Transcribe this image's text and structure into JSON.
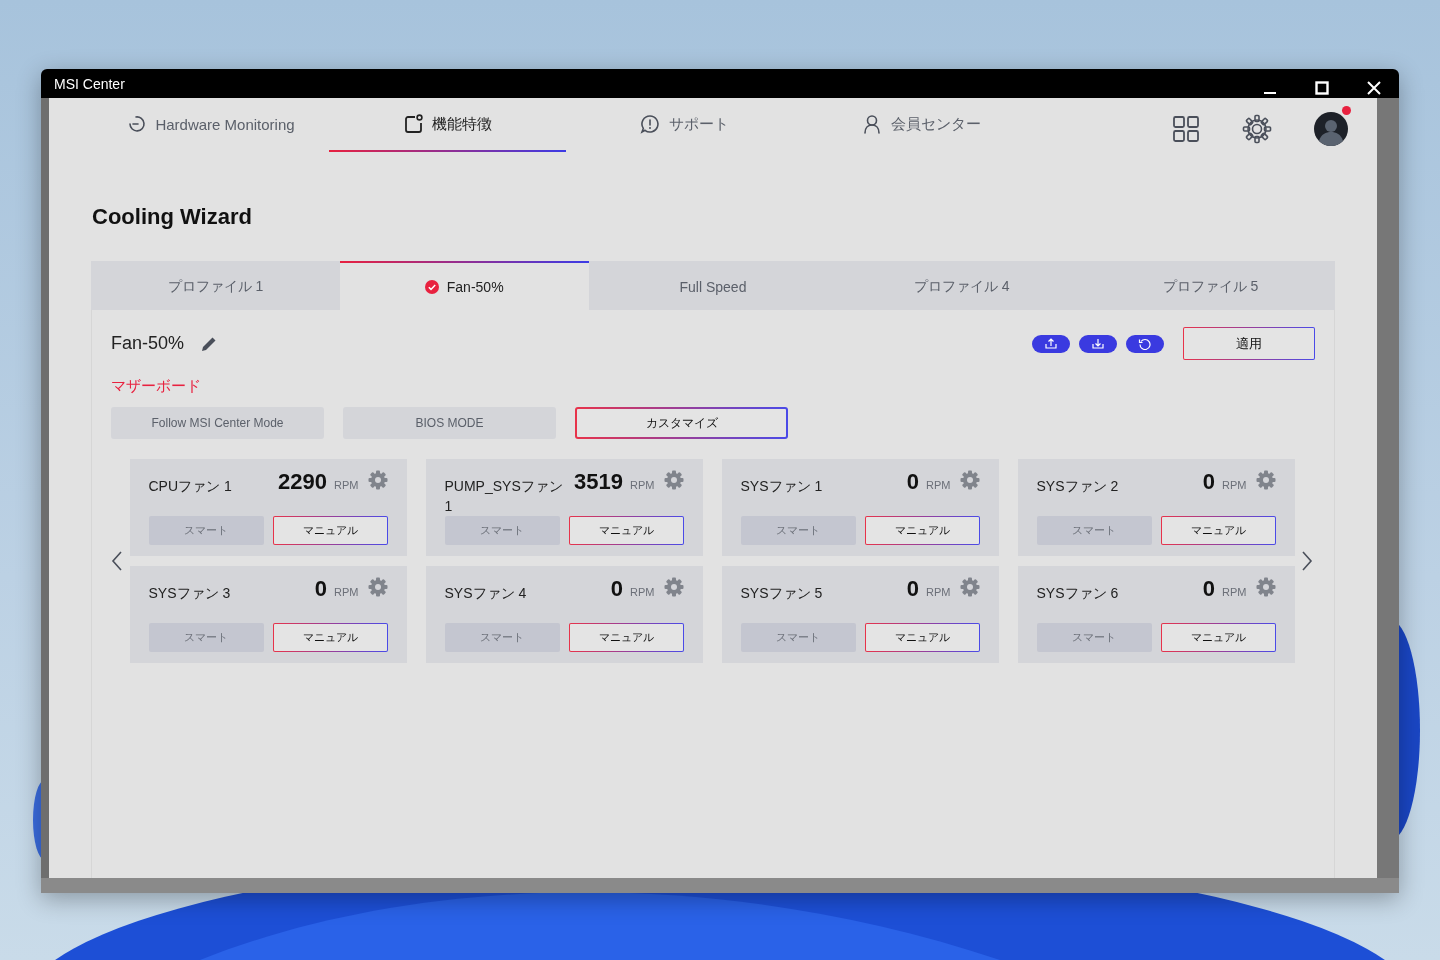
{
  "window": {
    "title": "MSI Center"
  },
  "nav_tabs": [
    {
      "label": "Hardware Monitoring",
      "selected": false,
      "kind": "monitor"
    },
    {
      "label": "機能特徴",
      "selected": true,
      "kind": "features"
    },
    {
      "label": "サポート",
      "selected": false,
      "kind": "support"
    },
    {
      "label": "会員センター",
      "selected": false,
      "kind": "member"
    }
  ],
  "account": {
    "notification": true
  },
  "page_title": "Cooling Wizard",
  "profile_tabs": [
    {
      "label": "プロファイル 1",
      "selected": false
    },
    {
      "label": "Fan-50%",
      "selected": true
    },
    {
      "label": "Full Speed",
      "selected": false
    },
    {
      "label": "プロファイル 4",
      "selected": false
    },
    {
      "label": "プロファイル 5",
      "selected": false
    }
  ],
  "profile": {
    "name": "Fan-50%",
    "apply_button": "適用"
  },
  "section_title": "マザーボード",
  "modes": [
    {
      "label": "Follow MSI Center Mode",
      "selected": false
    },
    {
      "label": "BIOS MODE",
      "selected": false
    },
    {
      "label": "カスタマイズ",
      "selected": true
    }
  ],
  "fans": [
    {
      "name": "CPUファン 1",
      "rpm": "2290",
      "unit": "RPM",
      "buttons": [
        {
          "label": "スマート",
          "selected": false
        },
        {
          "label": "マニュアル",
          "selected": true
        }
      ]
    },
    {
      "name": "PUMP_SYSファン 1",
      "rpm": "3519",
      "unit": "RPM",
      "buttons": [
        {
          "label": "スマート",
          "selected": false
        },
        {
          "label": "マニュアル",
          "selected": true
        }
      ]
    },
    {
      "name": "SYSファン 1",
      "rpm": "0",
      "unit": "RPM",
      "buttons": [
        {
          "label": "スマート",
          "selected": false
        },
        {
          "label": "マニュアル",
          "selected": true
        }
      ]
    },
    {
      "name": "SYSファン 2",
      "rpm": "0",
      "unit": "RPM",
      "buttons": [
        {
          "label": "スマート",
          "selected": false
        },
        {
          "label": "マニュアル",
          "selected": true
        }
      ]
    },
    {
      "name": "SYSファン 3",
      "rpm": "0",
      "unit": "RPM",
      "buttons": [
        {
          "label": "スマート",
          "selected": false
        },
        {
          "label": "マニュアル",
          "selected": true
        }
      ]
    },
    {
      "name": "SYSファン 4",
      "rpm": "0",
      "unit": "RPM",
      "buttons": [
        {
          "label": "スマート",
          "selected": false
        },
        {
          "label": "マニュアル",
          "selected": true
        }
      ]
    },
    {
      "name": "SYSファン 5",
      "rpm": "0",
      "unit": "RPM",
      "buttons": [
        {
          "label": "スマート",
          "selected": false
        },
        {
          "label": "マニュアル",
          "selected": true
        }
      ]
    },
    {
      "name": "SYSファン 6",
      "rpm": "0",
      "unit": "RPM",
      "buttons": [
        {
          "label": "スマート",
          "selected": false
        },
        {
          "label": "マニュアル",
          "selected": true
        }
      ]
    }
  ]
}
